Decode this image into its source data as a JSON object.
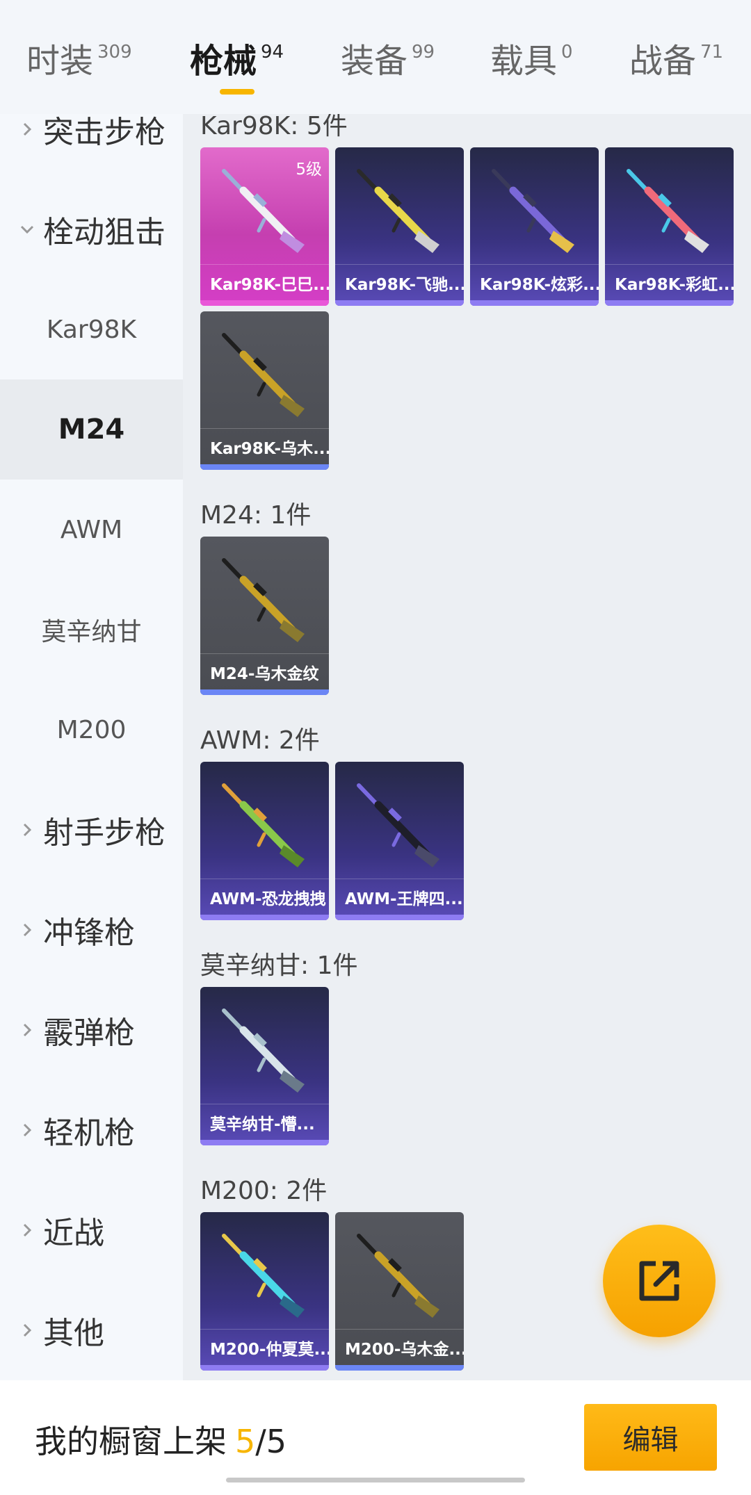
{
  "tabs": [
    {
      "label": "时装",
      "count": "309"
    },
    {
      "label": "枪械",
      "count": "94"
    },
    {
      "label": "装备",
      "count": "99"
    },
    {
      "label": "载具",
      "count": "0"
    },
    {
      "label": "战备",
      "count": "71"
    }
  ],
  "sidebar": {
    "items": [
      {
        "label": "突击步枪",
        "type": "category",
        "expanded": false
      },
      {
        "label": "栓动狙击",
        "type": "category",
        "expanded": true
      },
      {
        "label": "Kar98K",
        "type": "sub"
      },
      {
        "label": "M24",
        "type": "sub",
        "active": true
      },
      {
        "label": "AWM",
        "type": "sub"
      },
      {
        "label": "莫辛纳甘",
        "type": "sub"
      },
      {
        "label": "M200",
        "type": "sub"
      },
      {
        "label": "射手步枪",
        "type": "category",
        "expanded": false
      },
      {
        "label": "冲锋枪",
        "type": "category",
        "expanded": false
      },
      {
        "label": "霰弹枪",
        "type": "category",
        "expanded": false
      },
      {
        "label": "轻机枪",
        "type": "category",
        "expanded": false
      },
      {
        "label": "近战",
        "type": "category",
        "expanded": false
      },
      {
        "label": "其他",
        "type": "category",
        "expanded": false
      }
    ]
  },
  "sections": [
    {
      "title": "Kar98K: 5件",
      "items": [
        {
          "name": "Kar98K-巳巳...",
          "rarity": "pink",
          "level": "5级",
          "colors": [
            "#f0f0f4",
            "#9ab0d8",
            "#c08de0"
          ]
        },
        {
          "name": "Kar98K-飞驰...",
          "rarity": "purple",
          "colors": [
            "#e8d84a",
            "#2a2a2a",
            "#d0d0d0"
          ]
        },
        {
          "name": "Kar98K-炫彩...",
          "rarity": "purple",
          "colors": [
            "#7a68d8",
            "#3a3a5a",
            "#e6c04a"
          ]
        },
        {
          "name": "Kar98K-彩虹...",
          "rarity": "purple",
          "colors": [
            "#f06a7a",
            "#4ac8e8",
            "#e0e0e0"
          ]
        },
        {
          "name": "Kar98K-乌木...",
          "rarity": "gray",
          "colors": [
            "#c9a227",
            "#1e1e1e",
            "#8a7a30"
          ]
        }
      ]
    },
    {
      "title": "M24: 1件",
      "items": [
        {
          "name": "M24-乌木金纹",
          "rarity": "gray",
          "colors": [
            "#c9a227",
            "#1e1e1e",
            "#8a7a30"
          ]
        }
      ]
    },
    {
      "title": "AWM: 2件",
      "items": [
        {
          "name": "AWM-恐龙拽拽",
          "rarity": "purple",
          "colors": [
            "#8ac84a",
            "#e0a03a",
            "#5a8a2a"
          ]
        },
        {
          "name": "AWM-王牌四...",
          "rarity": "purple",
          "colors": [
            "#1e1e2a",
            "#7a6ae0",
            "#4a4a6a"
          ]
        }
      ]
    },
    {
      "title": "莫辛纳甘: 1件",
      "items": [
        {
          "name": "莫辛纳甘-懵...",
          "rarity": "purple",
          "colors": [
            "#d8e4ea",
            "#a8c0cc",
            "#6a7a8a"
          ]
        }
      ]
    },
    {
      "title": "M200: 2件",
      "items": [
        {
          "name": "M200-仲夏莫...",
          "rarity": "purple",
          "colors": [
            "#4ad8e8",
            "#e8c84a",
            "#2a6a8a"
          ]
        },
        {
          "name": "M200-乌木金...",
          "rarity": "gray",
          "colors": [
            "#c9a227",
            "#1e1e1e",
            "#8a7a30"
          ]
        }
      ]
    }
  ],
  "fab": {
    "icon": "share-external-icon"
  },
  "footer": {
    "showcase_label": "我的橱窗上架",
    "showcase_current": "5",
    "showcase_separator": "/",
    "showcase_total": "5",
    "edit_label": "编辑"
  },
  "colors": {
    "accent": "#f7b500",
    "rarity_pink": "#d53ec7",
    "rarity_purple": "#5a4bb8",
    "rarity_gray": "#55575e"
  }
}
